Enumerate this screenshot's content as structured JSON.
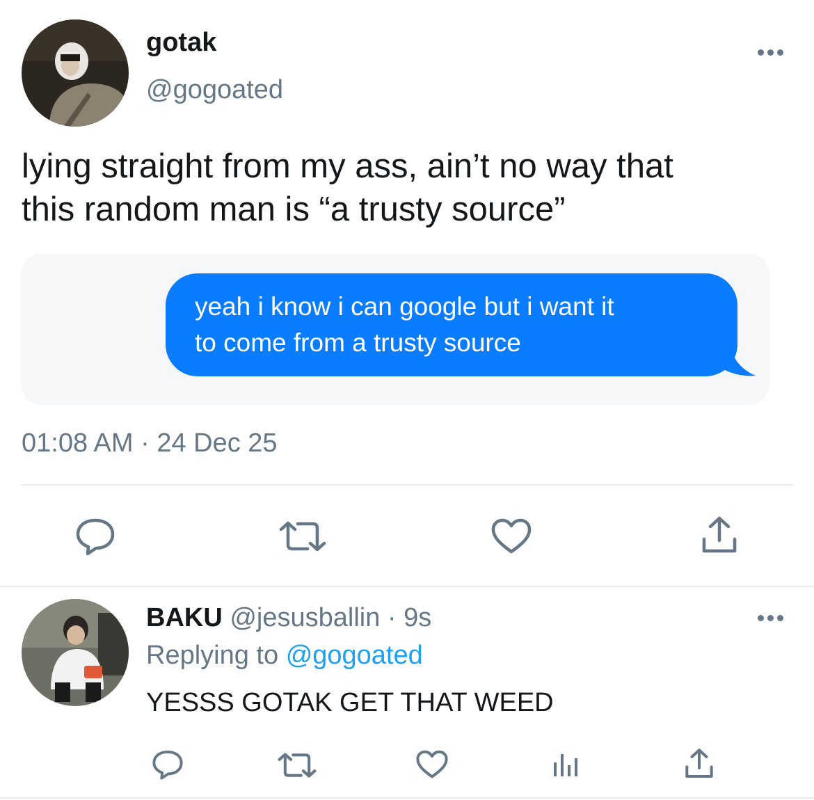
{
  "tweet": {
    "display_name": "gotak",
    "handle": "@gogoated",
    "text_line1": "lying straight from my ass, ain’t no way that",
    "text_line2": "this random man is “a trusty source”",
    "embedded_message": {
      "line1": "yeah i know i can google but i want it",
      "line2": "to come from a trusty source",
      "bubble_color": "#0a7cff"
    },
    "timestamp": "01:08 AM · 24 Dec 25",
    "actions": [
      "reply-icon",
      "retweet-icon",
      "like-icon",
      "share-icon"
    ]
  },
  "reply": {
    "display_name": "BAKU",
    "handle": "@jesusballin",
    "time": "· 9s",
    "replying_prefix": "Replying to",
    "replying_to": "@gogoated",
    "text": "YESSS GOTAK GET THAT WEED",
    "actions": [
      "reply-icon",
      "retweet-icon",
      "like-icon",
      "analytics-icon",
      "share-icon"
    ]
  },
  "colors": {
    "text": "#14171a",
    "muted": "#657786",
    "link": "#1da1f2",
    "divider": "#e6ecf0"
  }
}
